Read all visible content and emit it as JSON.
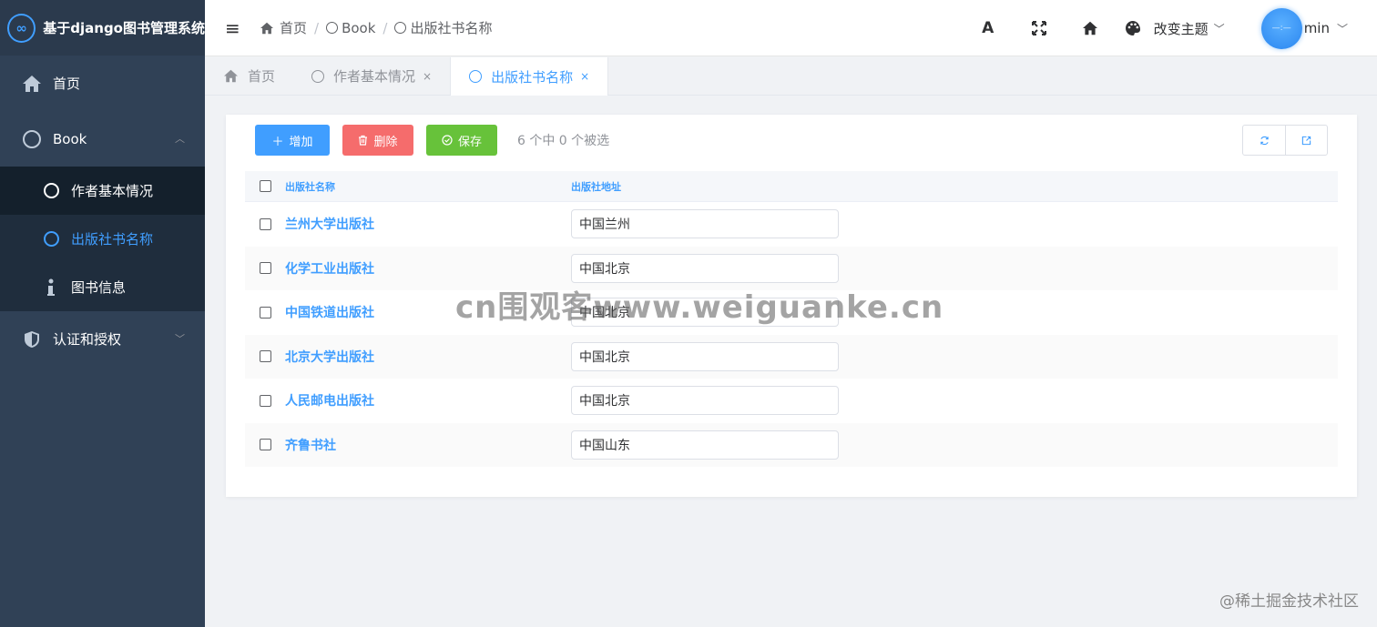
{
  "app": {
    "title": "基于django图书管理系统",
    "logo_glyph": "∞"
  },
  "sidebar": {
    "items": [
      {
        "label": "首页",
        "icon": "home-icon"
      },
      {
        "label": "Book",
        "icon": "circle-icon",
        "arrow": "︿"
      },
      {
        "label": "作者基本情况",
        "icon": "circle-icon"
      },
      {
        "label": "出版社书名称",
        "icon": "circle-icon",
        "active": true
      },
      {
        "label": "图书信息",
        "icon": "info-icon"
      },
      {
        "label": "认证和授权",
        "icon": "shield-icon",
        "arrow": "﹀"
      }
    ]
  },
  "header": {
    "breadcrumb": [
      "首页",
      "Book",
      "出版社书名称"
    ],
    "font_icon": "A",
    "theme_label": "改变主题",
    "user_name": "min",
    "avatar_text": "—:—"
  },
  "tags": [
    {
      "label": "首页"
    },
    {
      "label": "作者基本情况",
      "close": "×"
    },
    {
      "label": "出版社书名称",
      "close": "×",
      "active": true
    }
  ],
  "toolbar": {
    "add_label": "增加",
    "delete_label": "删除",
    "save_label": "保存",
    "selection_text": "6 个中 0 个被选"
  },
  "table": {
    "columns": [
      "出版社名称",
      "出版社地址"
    ],
    "rows": [
      {
        "name": "兰州大学出版社",
        "address": "中国兰州"
      },
      {
        "name": "化学工业出版社",
        "address": "中国北京"
      },
      {
        "name": "中国铁道出版社",
        "address": "中国北京"
      },
      {
        "name": "北京大学出版社",
        "address": "中国北京"
      },
      {
        "name": "人民邮电出版社",
        "address": "中国北京"
      },
      {
        "name": "齐鲁书社",
        "address": "中国山东"
      }
    ]
  },
  "watermark": "cn围观客www.weiguanke.cn",
  "footer_watermark": "@稀土掘金技术社区",
  "colors": {
    "sidebar_bg": "#304156",
    "primary": "#409eff",
    "danger": "#f56c6c",
    "success": "#67c23a"
  }
}
